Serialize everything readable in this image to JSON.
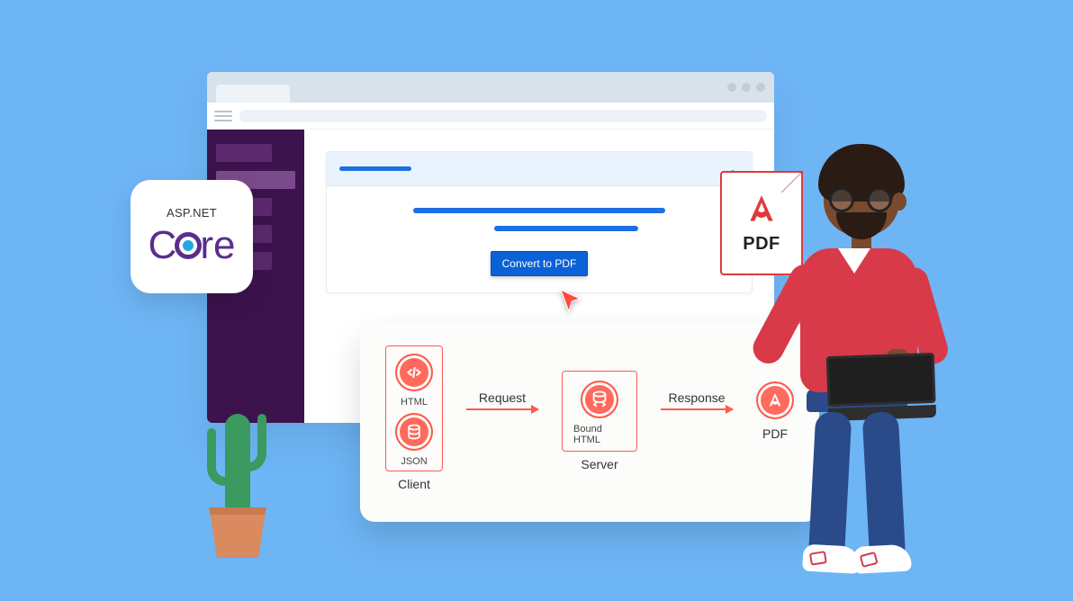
{
  "aspnet": {
    "top_label": "ASP.NET",
    "word": "Core"
  },
  "pdf_badge": {
    "label": "PDF"
  },
  "browser": {
    "button_label": "Convert to PDF"
  },
  "flow": {
    "client": {
      "group_label": "Client",
      "html_label": "HTML",
      "json_label": "JSON"
    },
    "request_label": "Request",
    "server": {
      "group_label": "Server",
      "bound_label": "Bound HTML"
    },
    "response_label": "Response",
    "output_label": "PDF"
  }
}
